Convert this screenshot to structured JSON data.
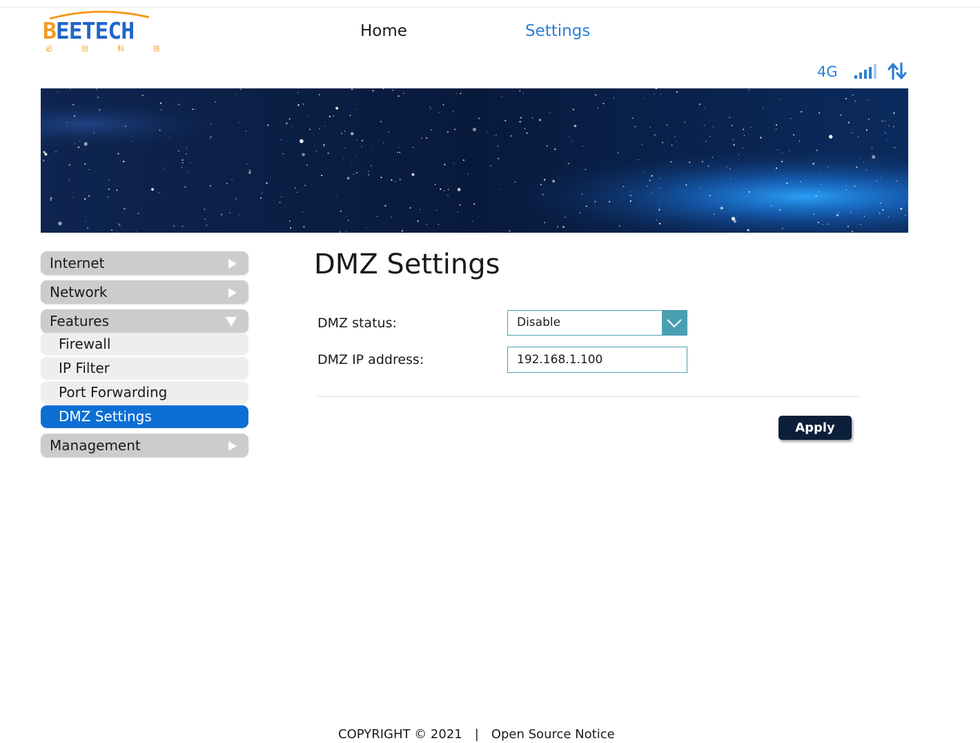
{
  "brand": {
    "logo_text_lead": "B",
    "logo_text_rest": "EETECH",
    "logo_subtitle_chars": [
      "必",
      "创",
      "科",
      "技"
    ],
    "colors": {
      "orange": "#f39a1d",
      "blue": "#1f66c9"
    }
  },
  "nav": {
    "home_label": "Home",
    "settings_label": "Settings",
    "active": "Settings"
  },
  "status": {
    "network_type": "4G",
    "signal_icon": "signal-bars-icon",
    "data_icon": "up-down-arrows-icon",
    "signal_level": 4,
    "signal_max": 5
  },
  "sidebar": {
    "items": [
      {
        "label": "Internet",
        "expanded": false
      },
      {
        "label": "Network",
        "expanded": false
      },
      {
        "label": "Features",
        "expanded": true,
        "children": [
          {
            "label": "Firewall",
            "active": false
          },
          {
            "label": "IP Filter",
            "active": false
          },
          {
            "label": "Port Forwarding",
            "active": false
          },
          {
            "label": "DMZ Settings",
            "active": true
          }
        ]
      },
      {
        "label": "Management",
        "expanded": false
      }
    ]
  },
  "main": {
    "title": "DMZ Settings",
    "dmz_status_label": "DMZ status:",
    "dmz_status_value": "Disable",
    "dmz_ip_label": "DMZ IP address:",
    "dmz_ip_value": "192.168.1.100",
    "apply_label": "Apply"
  },
  "footer": {
    "copyright": "COPYRIGHT © 2021",
    "separator": "|",
    "open_source": "Open Source Notice"
  },
  "colors": {
    "accent": "#2b7fd6",
    "active_menu": "#0d6fd3",
    "menu_bg": "#cccccc",
    "submenu_bg": "#eeeeee",
    "input_border": "#4a9fb0",
    "apply_bg": "#0b1f3a"
  }
}
